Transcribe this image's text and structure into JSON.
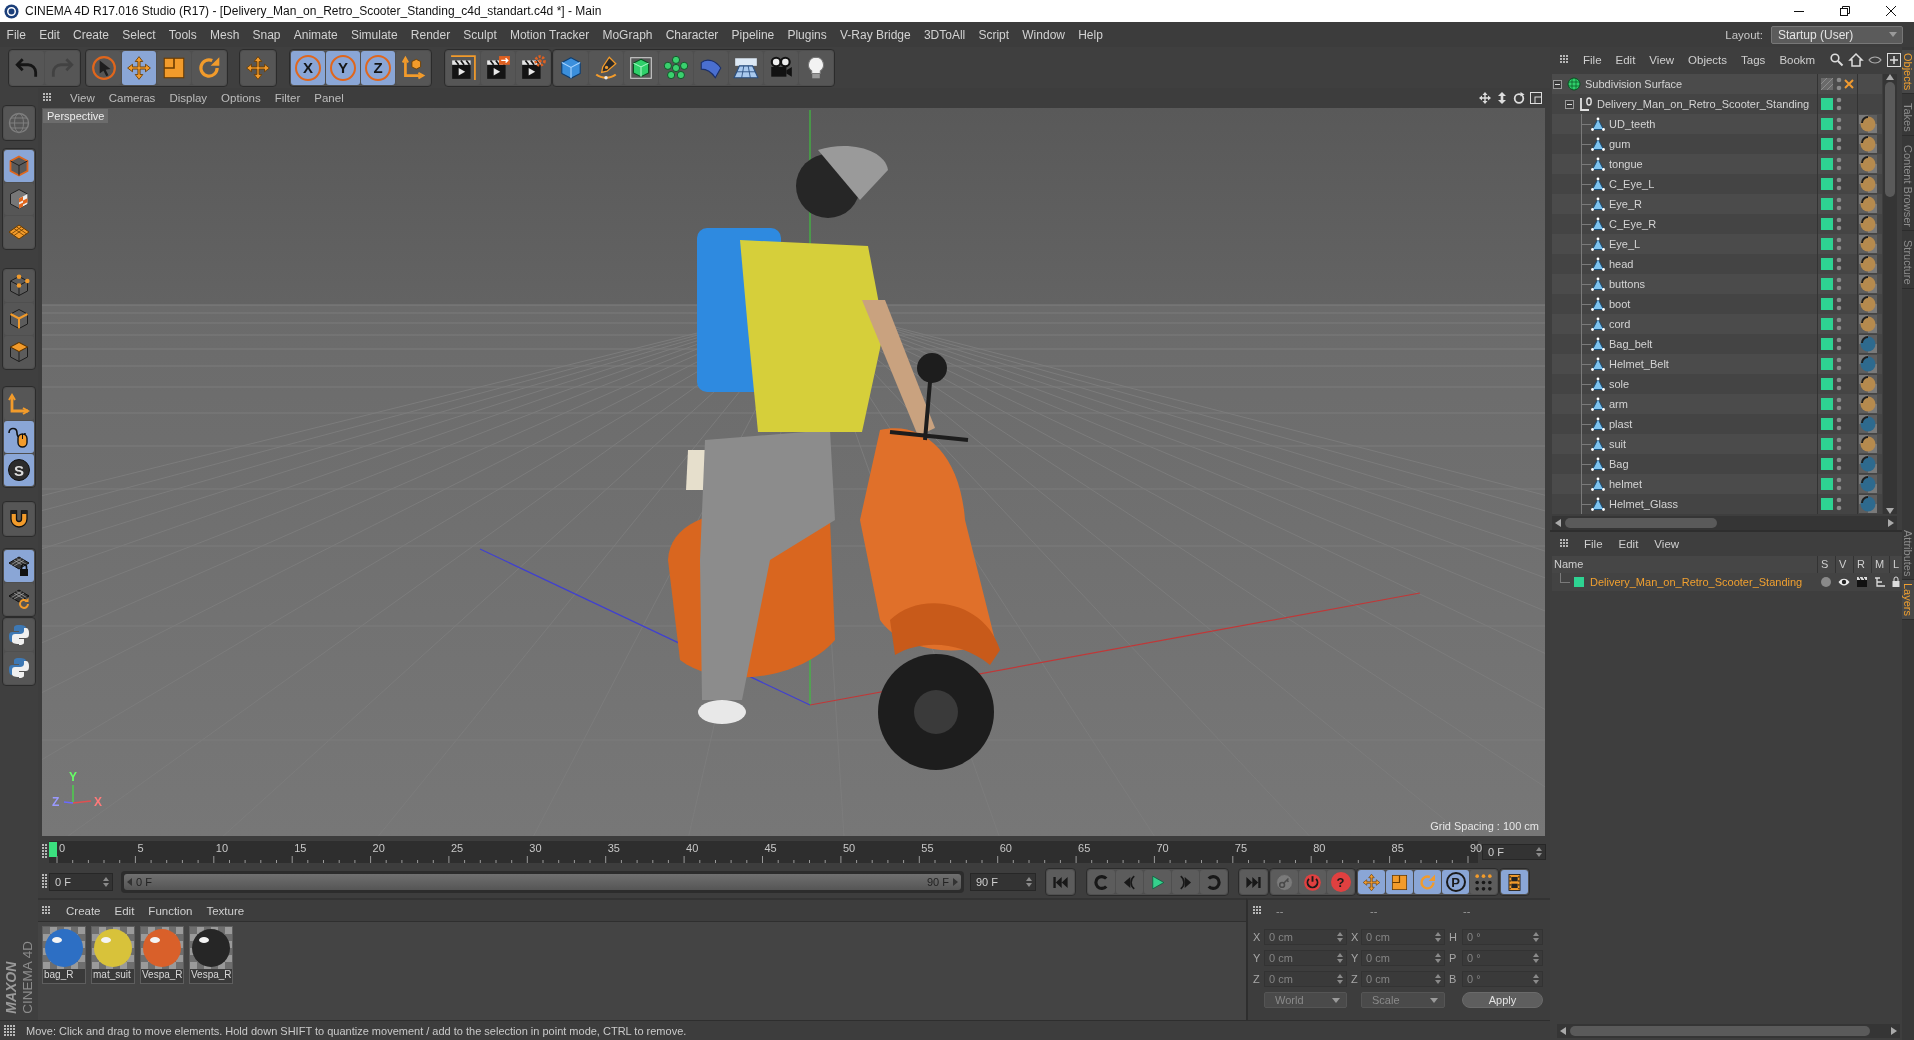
{
  "window": {
    "title": "CINEMA 4D R17.016 Studio (R17) - [Delivery_Man_on_Retro_Scooter_Standing_c4d_standart.c4d *] - Main"
  },
  "menu_bar": {
    "items": [
      "File",
      "Edit",
      "Create",
      "Select",
      "Tools",
      "Mesh",
      "Snap",
      "Animate",
      "Simulate",
      "Render",
      "Sculpt",
      "Motion Tracker",
      "MoGraph",
      "Character",
      "Pipeline",
      "Plugins",
      "V-Ray Bridge",
      "3DToAll",
      "Script",
      "Window",
      "Help"
    ],
    "layout_label": "Layout:",
    "layout": "Startup (User)"
  },
  "toolbar": {
    "groups": [
      {
        "tools": [
          {
            "kind": "undo",
            "selected": false,
            "disabled": false
          },
          {
            "kind": "redo",
            "selected": false,
            "disabled": true
          }
        ]
      },
      {
        "tools": [
          {
            "kind": "select",
            "selected": false,
            "disabled": false
          },
          {
            "kind": "move",
            "selected": true,
            "disabled": false
          },
          {
            "kind": "scale",
            "selected": false,
            "disabled": false
          },
          {
            "kind": "rotate",
            "selected": false,
            "disabled": false
          }
        ]
      },
      {
        "tools": [
          {
            "kind": "transform",
            "selected": false,
            "disabled": false
          }
        ]
      },
      {
        "tools": [
          {
            "kind": "axis_lock",
            "label": "X",
            "selected": true,
            "disabled": false
          },
          {
            "kind": "axis_lock",
            "label": "Y",
            "selected": true,
            "disabled": false
          },
          {
            "kind": "axis_lock",
            "label": "Z",
            "selected": true,
            "disabled": false
          },
          {
            "kind": "coords",
            "selected": false,
            "disabled": false
          }
        ]
      },
      {
        "tools": [
          {
            "kind": "render_view",
            "selected": false,
            "disabled": false
          },
          {
            "kind": "render_picture",
            "selected": false,
            "disabled": false
          },
          {
            "kind": "render_settings",
            "selected": false,
            "disabled": false
          }
        ]
      },
      {
        "tools": [
          {
            "kind": "cube",
            "selected": false,
            "disabled": false
          },
          {
            "kind": "pen",
            "selected": false,
            "disabled": false
          },
          {
            "kind": "subdivision",
            "selected": false,
            "disabled": false
          },
          {
            "kind": "cloner",
            "selected": false,
            "disabled": false
          },
          {
            "kind": "deformer",
            "selected": false,
            "disabled": false
          },
          {
            "kind": "floor",
            "selected": false,
            "disabled": false
          },
          {
            "kind": "camera",
            "selected": false,
            "disabled": false
          },
          {
            "kind": "light",
            "selected": false,
            "disabled": false
          }
        ]
      }
    ]
  },
  "side_toolbar": {
    "groups": [
      {
        "tools": [
          {
            "kind": "globe",
            "selected": false,
            "disabled": true
          }
        ]
      },
      {
        "tools": [
          {
            "kind": "model",
            "selected": true,
            "disabled": false
          },
          {
            "kind": "texture",
            "selected": false,
            "disabled": false
          },
          {
            "kind": "workplane",
            "selected": false,
            "disabled": false
          }
        ]
      },
      {
        "tools": [
          {
            "kind": "points",
            "selected": false,
            "disabled": false
          },
          {
            "kind": "edges",
            "selected": false,
            "disabled": false
          },
          {
            "kind": "polygons",
            "selected": false,
            "disabled": false
          }
        ]
      },
      {
        "tools": [
          {
            "kind": "axis_mode",
            "selected": false,
            "disabled": false
          },
          {
            "kind": "tweak",
            "selected": true,
            "disabled": false
          },
          {
            "kind": "snap",
            "label": "S",
            "selected": true,
            "disabled": false
          }
        ]
      },
      {
        "tools": [
          {
            "kind": "magnet",
            "selected": false,
            "disabled": false
          }
        ]
      },
      {
        "tools": [
          {
            "kind": "grid_lock",
            "selected": true,
            "disabled": false
          },
          {
            "kind": "grid_refresh",
            "selected": false,
            "disabled": false
          }
        ]
      },
      {
        "tools": [
          {
            "kind": "python",
            "selected": false,
            "disabled": false
          },
          {
            "kind": "python",
            "selected": false,
            "disabled": false
          }
        ]
      }
    ]
  },
  "viewport": {
    "menu": [
      "View",
      "Cameras",
      "Display",
      "Options",
      "Filter",
      "Panel"
    ],
    "camera": "Perspective",
    "grid_spacing": "Grid Spacing : 100 cm",
    "gizmo": {
      "y": "Y",
      "z": "Z",
      "x": "X"
    }
  },
  "timeline": {
    "ticks": [
      "0",
      "5",
      "10",
      "15",
      "20",
      "25",
      "30",
      "35",
      "40",
      "45",
      "50",
      "55",
      "60",
      "65",
      "70",
      "75",
      "80",
      "85",
      "90"
    ],
    "playhead": {
      "level": 0
    },
    "frame": "0 F"
  },
  "playback": {
    "start": "0 F",
    "range": {
      "start": "0 F",
      "end": "90 F",
      "level": 1
    },
    "end": "90 F",
    "groups": [
      {
        "buttons": [
          {
            "kind": "first"
          }
        ]
      },
      {
        "buttons": [
          {
            "kind": "prev_key"
          },
          {
            "kind": "prev_frame"
          },
          {
            "kind": "play"
          },
          {
            "kind": "next_frame"
          },
          {
            "kind": "next_key"
          }
        ]
      },
      {
        "buttons": [
          {
            "kind": "last"
          }
        ]
      },
      {
        "buttons": [
          {
            "kind": "record_key"
          },
          {
            "kind": "autokey"
          },
          {
            "kind": "key_help",
            "label": "?"
          }
        ]
      },
      {
        "buttons": [
          {
            "kind": "key_move",
            "selected": true
          },
          {
            "kind": "key_scale",
            "selected": true
          },
          {
            "kind": "key_rotate",
            "selected": true
          },
          {
            "kind": "key_param",
            "label": "P",
            "selected": true
          },
          {
            "kind": "key_points",
            "selected": false
          }
        ]
      },
      {
        "buttons": [
          {
            "kind": "film",
            "selected": true
          }
        ]
      }
    ]
  },
  "materials": {
    "menu": [
      "Create",
      "Edit",
      "Function",
      "Texture"
    ],
    "items": [
      {
        "name": "bag_R",
        "color": "#2d6fc4"
      },
      {
        "name": "mat_suit",
        "color": "#d8c23a"
      },
      {
        "name": "Vespa_R",
        "color": "#d9602a"
      },
      {
        "name": "Vespa_R",
        "color": "#262626"
      }
    ]
  },
  "coordinates": {
    "headers": [
      "--",
      "--",
      "--"
    ],
    "rows": [
      {
        "position_axis": "X",
        "position": "0 cm",
        "size_axis": "X",
        "size": "0 cm",
        "rotation_axis": "H",
        "rotation": "0 °"
      },
      {
        "position_axis": "Y",
        "position": "0 cm",
        "size_axis": "Y",
        "size": "0 cm",
        "rotation_axis": "P",
        "rotation": "0 °"
      },
      {
        "position_axis": "Z",
        "position": "0 cm",
        "size_axis": "Z",
        "size": "0 cm",
        "rotation_axis": "B",
        "rotation": "0 °"
      }
    ],
    "mode": "World",
    "transform": "Scale",
    "apply": "Apply"
  },
  "logo": {
    "wordmark": "MAXON",
    "product": "CINEMA 4D"
  },
  "status_bar": {
    "text": "Move: Click and drag to move elements. Hold down SHIFT to quantize movement / add to the selection in point mode, CTRL to remove."
  },
  "objects": {
    "menu": [
      "File",
      "Edit",
      "View",
      "Objects",
      "Tags",
      "Bookm"
    ],
    "tree": [
      {
        "name": "Subdivision Surface",
        "kind": "generator",
        "expanded": true,
        "enabled": false,
        "children": [
          {
            "name": "Delivery_Man_on_Retro_Scooter_Standing",
            "kind": "null",
            "expanded": true,
            "layer": {
              "color": "#2ed392"
            },
            "children": [
              {
                "name": "UD_teeth",
                "kind": "polygon",
                "layer": {
                  "color": "#2ed392"
                },
                "material": {
                  "color": "#b58a4e"
                }
              },
              {
                "name": "gum",
                "kind": "polygon",
                "layer": {
                  "color": "#2ed392"
                },
                "material": {
                  "color": "#b58a4e"
                }
              },
              {
                "name": "tongue",
                "kind": "polygon",
                "layer": {
                  "color": "#2ed392"
                },
                "material": {
                  "color": "#b58a4e"
                }
              },
              {
                "name": "C_Eye_L",
                "kind": "polygon",
                "layer": {
                  "color": "#2ed392"
                },
                "material": {
                  "color": "#b58a4e"
                }
              },
              {
                "name": "Eye_R",
                "kind": "polygon",
                "layer": {
                  "color": "#2ed392"
                },
                "material": {
                  "color": "#b58a4e"
                }
              },
              {
                "name": "C_Eye_R",
                "kind": "polygon",
                "layer": {
                  "color": "#2ed392"
                },
                "material": {
                  "color": "#b58a4e"
                }
              },
              {
                "name": "Eye_L",
                "kind": "polygon",
                "layer": {
                  "color": "#2ed392"
                },
                "material": {
                  "color": "#b58a4e"
                }
              },
              {
                "name": "head",
                "kind": "polygon",
                "layer": {
                  "color": "#2ed392"
                },
                "material": {
                  "color": "#b58a4e"
                }
              },
              {
                "name": "buttons",
                "kind": "polygon",
                "layer": {
                  "color": "#2ed392"
                },
                "material": {
                  "color": "#b58a4e"
                }
              },
              {
                "name": "boot",
                "kind": "polygon",
                "layer": {
                  "color": "#2ed392"
                },
                "material": {
                  "color": "#b58a4e"
                }
              },
              {
                "name": "cord",
                "kind": "polygon",
                "layer": {
                  "color": "#2ed392"
                },
                "material": {
                  "color": "#b58a4e"
                }
              },
              {
                "name": "Bag_belt",
                "kind": "polygon",
                "layer": {
                  "color": "#2ed392"
                },
                "material": {
                  "color": "#2e6a8e"
                }
              },
              {
                "name": "Helmet_Belt",
                "kind": "polygon",
                "layer": {
                  "color": "#2ed392"
                },
                "material": {
                  "color": "#2e6a8e"
                }
              },
              {
                "name": "sole",
                "kind": "polygon",
                "layer": {
                  "color": "#2ed392"
                },
                "material": {
                  "color": "#b58a4e"
                }
              },
              {
                "name": "arm",
                "kind": "polygon",
                "layer": {
                  "color": "#2ed392"
                },
                "material": {
                  "color": "#b58a4e"
                }
              },
              {
                "name": "plast",
                "kind": "polygon",
                "layer": {
                  "color": "#2ed392"
                },
                "material": {
                  "color": "#2e6a8e"
                }
              },
              {
                "name": "suit",
                "kind": "polygon",
                "layer": {
                  "color": "#2ed392"
                },
                "material": {
                  "color": "#b58a4e"
                }
              },
              {
                "name": "Bag",
                "kind": "polygon",
                "layer": {
                  "color": "#2ed392"
                },
                "material": {
                  "color": "#2e6a8e"
                }
              },
              {
                "name": "helmet",
                "kind": "polygon",
                "layer": {
                  "color": "#2ed392"
                },
                "material": {
                  "color": "#2e6a8e"
                }
              },
              {
                "name": "Helmet_Glass",
                "kind": "polygon",
                "layer": {
                  "color": "#2ed392"
                },
                "material": {
                  "color": "#2e6a8e"
                }
              }
            ]
          }
        ]
      }
    ]
  },
  "layers": {
    "menu": [
      "File",
      "Edit",
      "View"
    ],
    "columns": [
      "Name",
      "S",
      "V",
      "R",
      "M",
      "L"
    ],
    "rows": [
      {
        "name": "Delivery_Man_on_Retro_Scooter_Standing",
        "color": "#2ed392"
      }
    ]
  },
  "side_tabs": {
    "upper": [
      {
        "label": "Objects",
        "selected": true
      },
      {
        "label": "Takes",
        "selected": false
      },
      {
        "label": "Content Browser",
        "selected": false
      },
      {
        "label": "Structure",
        "selected": false
      }
    ],
    "lower": [
      {
        "label": "Attributes",
        "selected": false
      },
      {
        "label": "Layers",
        "selected": true
      }
    ]
  }
}
